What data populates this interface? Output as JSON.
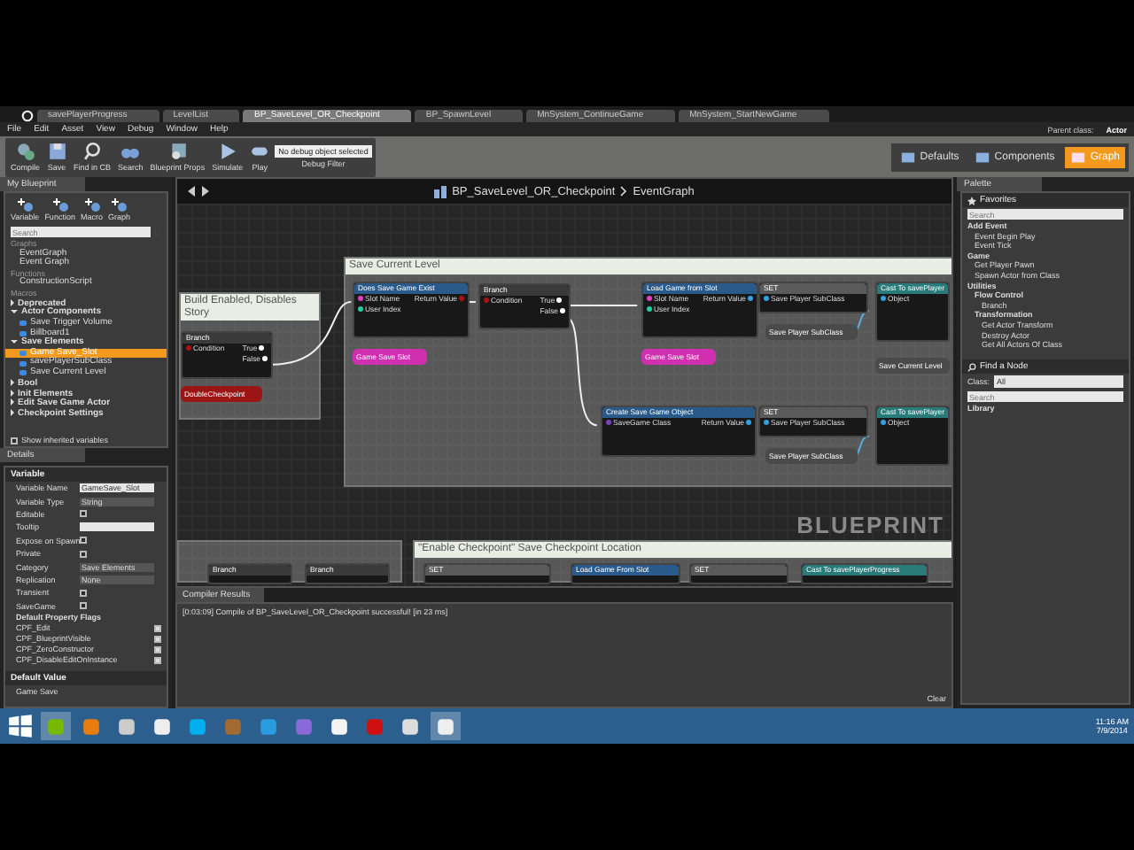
{
  "editor_tabs": [
    {
      "label": "savePlayerProgress",
      "selected": false
    },
    {
      "label": "LevelList",
      "selected": false
    },
    {
      "label": "BP_SaveLevel_OR_Checkpoint",
      "selected": true
    },
    {
      "label": "BP_SpawnLevel",
      "selected": false
    },
    {
      "label": "MnSystem_ContinueGame",
      "selected": false
    },
    {
      "label": "MnSystem_StartNewGame",
      "selected": false
    }
  ],
  "menu": [
    "File",
    "Edit",
    "Asset",
    "View",
    "Debug",
    "Window",
    "Help"
  ],
  "parent_class": {
    "label": "Parent class:",
    "value": "Actor"
  },
  "toolbar": [
    {
      "label": "Compile",
      "kind": "compile"
    },
    {
      "label": "Save",
      "kind": "save"
    },
    {
      "label": "Find in CB",
      "kind": "find"
    },
    {
      "label": "Search",
      "kind": "search"
    },
    {
      "label": "Blueprint Props",
      "kind": "props"
    },
    {
      "label": "Simulate",
      "kind": "simulate"
    },
    {
      "label": "Play",
      "kind": "play"
    }
  ],
  "debug": {
    "value": "No debug object selected",
    "label": "Debug Filter"
  },
  "modes": [
    {
      "label": "Defaults",
      "selected": false
    },
    {
      "label": "Components",
      "selected": false
    },
    {
      "label": "Graph",
      "selected": true
    }
  ],
  "my_blueprint": {
    "tab": "My Blueprint",
    "add_buttons": [
      "Variable",
      "Function",
      "Macro",
      "Graph"
    ],
    "search_placeholder": "Search",
    "sections": [
      {
        "title": "Graphs",
        "items": [
          "EventGraph",
          "Event Graph"
        ]
      },
      {
        "title": "Functions",
        "items": [
          "ConstructionScript"
        ]
      },
      {
        "title": "Macros"
      }
    ],
    "categories": [
      {
        "label": "Deprecated",
        "expanded": false
      },
      {
        "label": "Actor Components",
        "expanded": true,
        "children": [
          {
            "label": "Save Trigger Volume",
            "selected": false
          },
          {
            "label": "Billboard1",
            "selected": false
          }
        ]
      },
      {
        "label": "Save Elements",
        "expanded": true,
        "children": [
          {
            "label": "Game Save_Slot",
            "selected": true
          },
          {
            "label": "savePlayerSubClass",
            "selected": false
          },
          {
            "label": "Save Current Level",
            "selected": false
          }
        ]
      },
      {
        "label": "Bool",
        "expanded": false
      },
      {
        "label": "Init Elements",
        "expanded": false
      },
      {
        "label": "Edit Save Game Actor",
        "expanded": false
      },
      {
        "label": "Checkpoint Settings",
        "expanded": false
      }
    ],
    "show_inherited": {
      "label": "Show inherited variables",
      "checked": false
    }
  },
  "details": {
    "tab": "Details",
    "section": "Variable",
    "rows": [
      {
        "kind": "text",
        "label": "Variable Name",
        "value": "GameSave_Slot"
      },
      {
        "kind": "dropdown",
        "label": "Variable Type",
        "value": "String"
      },
      {
        "kind": "checkbox",
        "label": "Editable",
        "checked": false
      },
      {
        "kind": "text",
        "label": "Tooltip"
      },
      {
        "kind": "checkbox",
        "label": "Expose on Spawn",
        "checked": false
      },
      {
        "kind": "checkbox",
        "label": "Private",
        "checked": false
      },
      {
        "kind": "dropdown",
        "label": "Category",
        "value": "Save Elements"
      },
      {
        "kind": "dropdown",
        "label": "Replication",
        "value": "None"
      },
      {
        "kind": "checkbox",
        "label": "Transient",
        "checked": false
      },
      {
        "kind": "checkbox",
        "label": "SaveGame",
        "checked": false
      },
      {
        "kind": "heading",
        "label": "Default Property Flags"
      },
      {
        "kind": "flag",
        "label": "CPF_Edit",
        "checked": true
      },
      {
        "kind": "flag",
        "label": "CPF_BlueprintVisible",
        "checked": true
      },
      {
        "kind": "flag",
        "label": "CPF_ZeroConstructor",
        "checked": true
      },
      {
        "kind": "flag",
        "label": "CPF_DisableEditOnInstance",
        "checked": true
      }
    ],
    "section_2": "Default Value",
    "default_row": "Game Save"
  },
  "graph": {
    "breadcrumb": "BP_SaveLevel_OR_Checkpoint",
    "sub": "EventGraph",
    "stamp": "BLUEPRINT",
    "comments": [
      "Build Enabled, Disables Story",
      "Save Current Level",
      "\"Enable Checkpoint\" Save Checkpoint Location"
    ],
    "nodes": [
      {
        "kind": "branch",
        "title": "Branch",
        "inputs": [
          {
            "label": "Condition",
            "color": "#b01010"
          }
        ],
        "outputs": [
          {
            "label": "True",
            "color": "#ffffff"
          },
          {
            "label": "False",
            "color": "#ffffff"
          }
        ]
      },
      {
        "kind": "variable",
        "title": "DoubleCheckpoint",
        "color": "#9b1515"
      },
      {
        "kind": "function",
        "title": "Does Save Game Exist",
        "inputs": [
          {
            "label": "Slot Name",
            "color": "#e040c0"
          },
          {
            "label": "User Index",
            "color": "#20d0a0"
          }
        ],
        "outputs": [
          {
            "label": "Return Value",
            "color": "#b01010"
          }
        ]
      },
      {
        "kind": "variable",
        "title": "Game Save Slot",
        "color": "#d030b0"
      },
      {
        "kind": "branch",
        "title": "Branch",
        "inputs": [
          {
            "label": "Condition",
            "color": "#b01010"
          }
        ],
        "outputs": [
          {
            "label": "True",
            "color": "#ffffff"
          },
          {
            "label": "False",
            "color": "#ffffff"
          }
        ]
      },
      {
        "kind": "function",
        "title": "Load Game from Slot",
        "inputs": [
          {
            "label": "Slot Name",
            "color": "#e040c0"
          },
          {
            "label": "User Index",
            "color": "#20d0a0"
          }
        ],
        "outputs": [
          {
            "label": "Return Value",
            "color": "#30a0e0"
          }
        ]
      },
      {
        "kind": "variable",
        "title": "Game Save Slot",
        "color": "#d030b0"
      },
      {
        "kind": "set",
        "title": "SET",
        "inputs": [
          {
            "label": "Save Player SubClass",
            "color": "#30a0e0"
          }
        ]
      },
      {
        "kind": "variable",
        "title": "Save Player SubClass",
        "color": "#4a4a4a"
      },
      {
        "kind": "cast",
        "title": "Cast To savePlayer",
        "inputs": [
          {
            "label": "Object",
            "color": "#30a0e0"
          }
        ]
      },
      {
        "kind": "variable",
        "title": "Save Current Level",
        "color": "#4a4a4a"
      },
      {
        "kind": "function",
        "title": "Create Save Game Object",
        "inputs": [
          {
            "label": "SaveGame Class",
            "color": "#8040c0"
          }
        ],
        "outputs": [
          {
            "label": "Return Value",
            "color": "#30a0e0"
          }
        ]
      },
      {
        "kind": "set",
        "title": "SET",
        "inputs": [
          {
            "label": "Save Player SubClass",
            "color": "#30a0e0"
          }
        ]
      },
      {
        "kind": "variable",
        "title": "Save Player SubClass",
        "color": "#4a4a4a"
      },
      {
        "kind": "cast",
        "title": "Cast To savePlayer",
        "inputs": [
          {
            "label": "Object",
            "color": "#30a0e0"
          }
        ]
      },
      {
        "kind": "branch",
        "title": "Branch"
      },
      {
        "kind": "branch",
        "title": "Branch"
      },
      {
        "kind": "set",
        "title": "SET"
      },
      {
        "kind": "function",
        "title": "Load Game From Slot"
      },
      {
        "kind": "set",
        "title": "SET"
      },
      {
        "kind": "cast",
        "title": "Cast To savePlayerProgress"
      }
    ]
  },
  "compiler": {
    "tab": "Compiler Results",
    "line": "[0:03:09] Compile of BP_SaveLevel_OR_Checkpoint successful! [in 23 ms]",
    "clear": "Clear"
  },
  "palette": {
    "tab": "Palette",
    "favorites": "Favorites",
    "search_placeholder": "Search",
    "tree": [
      {
        "label": "Add Event",
        "children": [
          {
            "label": "Event Begin Play"
          },
          {
            "label": "Event Tick"
          }
        ]
      },
      {
        "label": "Game",
        "children": [
          {
            "label": "Get Player Pawn"
          },
          {
            "label": "Spawn Actor from Class"
          }
        ]
      },
      {
        "label": "Utilities",
        "children": [
          {
            "label": "Flow Control",
            "children": [
              {
                "label": "Branch"
              }
            ]
          },
          {
            "label": "Transformation",
            "children": [
              {
                "label": "Get Actor Transform"
              },
              {
                "label": "Destroy Actor"
              },
              {
                "label": "Get All Actors Of Class"
              }
            ]
          }
        ]
      }
    ],
    "find_node": "Find a Node",
    "class_label": "Class:",
    "class_value": "All",
    "search2_placeholder": "Search",
    "library": "Library"
  },
  "taskbar": {
    "apps": [
      {
        "kind": "nvidia",
        "selected": true
      },
      {
        "kind": "blender",
        "selected": false
      },
      {
        "kind": "mask",
        "selected": false
      },
      {
        "kind": "unreal",
        "selected": false
      },
      {
        "kind": "skype",
        "selected": false
      },
      {
        "kind": "bronze",
        "selected": false
      },
      {
        "kind": "photoshop",
        "selected": false
      },
      {
        "kind": "vs",
        "selected": false
      },
      {
        "kind": "doc",
        "selected": false
      },
      {
        "kind": "ati",
        "selected": false
      },
      {
        "kind": "steam",
        "selected": false
      },
      {
        "kind": "unreal",
        "selected": true
      }
    ],
    "time": "11:16 AM",
    "date": "7/9/2014"
  }
}
